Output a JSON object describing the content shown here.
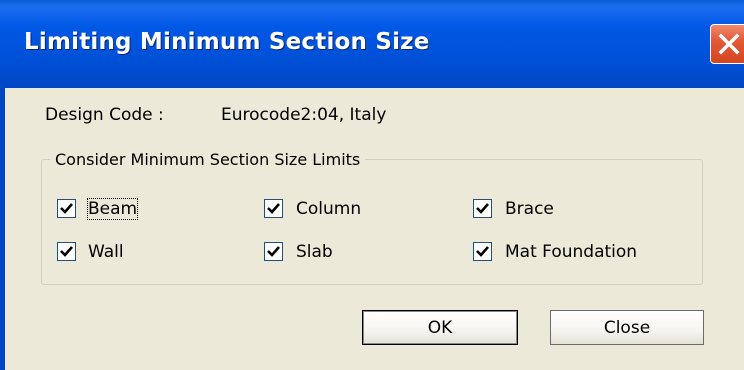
{
  "window": {
    "title": "Limiting Minimum Section Size",
    "close_icon": "close-icon"
  },
  "design_code": {
    "label": "Design Code :",
    "value": "Eurocode2:04, Italy"
  },
  "group": {
    "legend": "Consider Minimum Section Size Limits",
    "items": [
      {
        "label": "Beam",
        "checked": true
      },
      {
        "label": "Column",
        "checked": true
      },
      {
        "label": "Brace",
        "checked": true
      },
      {
        "label": "Wall",
        "checked": true
      },
      {
        "label": "Slab",
        "checked": true
      },
      {
        "label": "Mat Foundation",
        "checked": true
      }
    ]
  },
  "buttons": {
    "ok": "OK",
    "close": "Close"
  }
}
